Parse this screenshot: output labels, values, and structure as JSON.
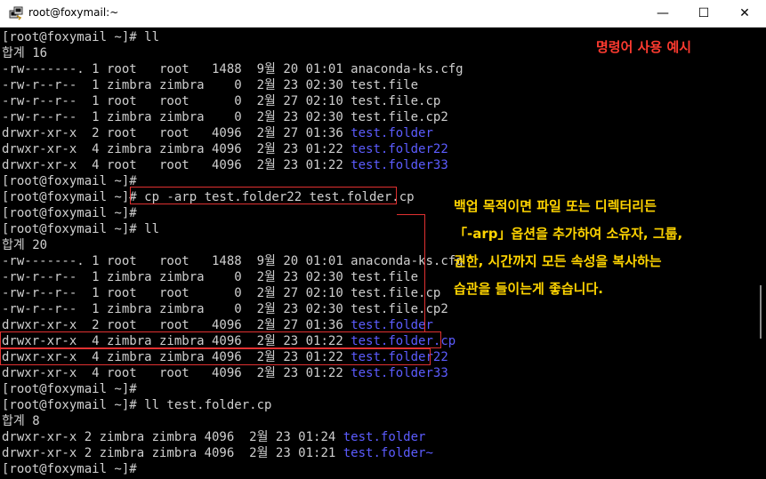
{
  "window": {
    "title": "root@foxymail:~",
    "minimize": "—",
    "maximize": "☐",
    "close": "✕",
    "icon": "putty-icon"
  },
  "terminal": {
    "lines": [
      {
        "text": "[root@foxymail ~]# ll"
      },
      {
        "text": "합계 16"
      },
      {
        "text": "-rw-------. 1 root   root   1488  9월 20 01:01 anaconda-ks.cfg"
      },
      {
        "text": "-rw-r--r--  1 zimbra zimbra    0  2월 23 02:30 test.file"
      },
      {
        "text": "-rw-r--r--  1 root   root      0  2월 27 02:10 test.file.cp"
      },
      {
        "text": "-rw-r--r--  1 zimbra zimbra    0  2월 23 02:30 test.file.cp2"
      },
      {
        "text": "drwxr-xr-x  2 root   root   4096  2월 27 01:36 ",
        "dir": "test.folder"
      },
      {
        "text": "drwxr-xr-x  4 zimbra zimbra 4096  2월 23 01:22 ",
        "dir": "test.folder22"
      },
      {
        "text": "drwxr-xr-x  4 root   root   4096  2월 23 01:22 ",
        "dir": "test.folder33"
      },
      {
        "text": "[root@foxymail ~]#"
      },
      {
        "text": "[root@foxymail ~]# cp -arp test.folder22 test.folder.cp"
      },
      {
        "text": "[root@foxymail ~]#"
      },
      {
        "text": "[root@foxymail ~]# ll"
      },
      {
        "text": "합계 20"
      },
      {
        "text": "-rw-------. 1 root   root   1488  9월 20 01:01 anaconda-ks.cfg"
      },
      {
        "text": "-rw-r--r--  1 zimbra zimbra    0  2월 23 02:30 test.file"
      },
      {
        "text": "-rw-r--r--  1 root   root      0  2월 27 02:10 test.file.cp"
      },
      {
        "text": "-rw-r--r--  1 zimbra zimbra    0  2월 23 02:30 test.file.cp2"
      },
      {
        "text": "drwxr-xr-x  2 root   root   4096  2월 27 01:36 ",
        "dir": "test.folder"
      },
      {
        "text": "drwxr-xr-x  4 zimbra zimbra 4096  2월 23 01:22 ",
        "dir": "test.folder.cp"
      },
      {
        "text": "drwxr-xr-x  4 zimbra zimbra 4096  2월 23 01:22 ",
        "dir": "test.folder22"
      },
      {
        "text": "drwxr-xr-x  4 root   root   4096  2월 23 01:22 ",
        "dir": "test.folder33"
      },
      {
        "text": "[root@foxymail ~]#"
      },
      {
        "text": "[root@foxymail ~]# ll test.folder.cp"
      },
      {
        "text": "합계 8"
      },
      {
        "text": "drwxr-xr-x 2 zimbra zimbra 4096  2월 23 01:24 ",
        "dir": "test.folder"
      },
      {
        "text": "drwxr-xr-x 2 zimbra zimbra 4096  2월 23 01:21 ",
        "dir": "test.folder~"
      },
      {
        "text": "[root@foxymail ~]#"
      }
    ]
  },
  "annotations": {
    "title": "명령어 사용 예시",
    "note_lines": [
      "백업 목적이면 파일 또는 디렉터리든",
      "「-arp」옵션을 추가하여 소유자, 그룹,",
      "권한, 시간까지 모든 속성을 복사하는",
      "습관을 들이는게 좋습니다."
    ]
  },
  "colors": {
    "terminal_bg": "#000000",
    "terminal_text": "#cfcfcf",
    "directory": "#5c5cff",
    "highlight_box": "#e03131",
    "annotation_title": "#ff3b30",
    "annotation_note": "#ffd400"
  }
}
